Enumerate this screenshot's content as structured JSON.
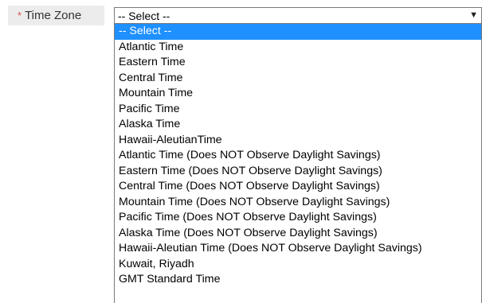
{
  "field": {
    "required_marker": "*",
    "label": "Time Zone",
    "selected_value": "-- Select --",
    "arrow_icon": "triangle-down-icon"
  },
  "colors": {
    "highlight": "#1e90ff",
    "required": "#d9534f",
    "label_bg": "#ececec"
  },
  "options": [
    "-- Select --",
    "Atlantic Time",
    "Eastern Time",
    "Central Time",
    "Mountain Time",
    "Pacific Time",
    "Alaska Time",
    "Hawaii-AleutianTime",
    "Atlantic Time (Does NOT Observe Daylight Savings)",
    "Eastern Time (Does NOT Observe Daylight Savings)",
    "Central Time (Does NOT Observe Daylight Savings)",
    "Mountain Time (Does NOT Observe Daylight Savings)",
    "Pacific Time (Does NOT Observe Daylight Savings)",
    "Alaska Time (Does NOT Observe Daylight Savings)",
    "Hawaii-Aleutian Time (Does NOT Observe Daylight Savings)",
    "Kuwait, Riyadh",
    "GMT Standard Time"
  ],
  "highlighted_index": 0
}
